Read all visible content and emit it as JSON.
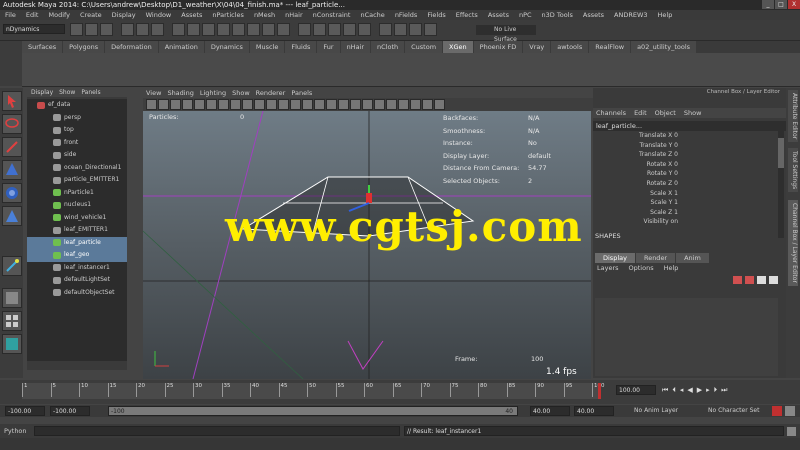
{
  "window": {
    "title": "Autodesk Maya 2014: C:\\Users\\andrew\\Desktop\\D1_weather\\X\\04\\04_finish.ma*   ---   leaf_particle...",
    "controls": [
      "_",
      "□",
      "X"
    ]
  },
  "menubar": [
    "File",
    "Edit",
    "Modify",
    "Create",
    "Display",
    "Window",
    "Assets",
    "nParticles",
    "nMesh",
    "nHair",
    "nConstraint",
    "nCache",
    "nFields",
    "Fields",
    "Effects",
    "Assets",
    "nPC",
    "n3D Tools",
    "Assets",
    "ANDREW3",
    "Help"
  ],
  "statusline": {
    "mode": "nDynamics",
    "live_surface": "No Live Surface"
  },
  "shelf_tabs": [
    "Surfaces",
    "Polygons",
    "Deformation",
    "Animation",
    "Dynamics",
    "Muscle",
    "Fluids",
    "Fur",
    "nHair",
    "nCloth",
    "Custom",
    "XGen",
    "Phoenix FD",
    "Vray",
    "awtools",
    "RealFlow",
    "a02_utility_tools"
  ],
  "shelf_active": "XGen",
  "outliner": {
    "menu": [
      "Display",
      "Show",
      "Panels"
    ],
    "items": [
      {
        "label": "ef_data",
        "color": "#c84c4c",
        "selected": false
      },
      {
        "label": "persp",
        "color": "#9a9a9a",
        "selected": false
      },
      {
        "label": "top",
        "color": "#9a9a9a",
        "selected": false
      },
      {
        "label": "front",
        "color": "#9a9a9a",
        "selected": false
      },
      {
        "label": "side",
        "color": "#9a9a9a",
        "selected": false
      },
      {
        "label": "ocean_Directional1",
        "color": "#9a9a9a",
        "selected": false
      },
      {
        "label": "particle_EMITTER1",
        "color": "#9a9a9a",
        "selected": false
      },
      {
        "label": "nParticle1",
        "color": "#6fbf4f",
        "selected": false
      },
      {
        "label": "nucleus1",
        "color": "#6fbf4f",
        "selected": false
      },
      {
        "label": "wind_vehicle1",
        "color": "#6fbf4f",
        "selected": false
      },
      {
        "label": "leaf_EMITTER1",
        "color": "#9a9a9a",
        "selected": false
      },
      {
        "label": "leaf_particle",
        "color": "#6fbf4f",
        "selected": true
      },
      {
        "label": "leaf_geo",
        "color": "#6fbf4f",
        "selected": true
      },
      {
        "label": "leaf_instancer1",
        "color": "#9a9a9a",
        "selected": false
      },
      {
        "label": "defaultLightSet",
        "color": "#9a9a9a",
        "selected": false
      },
      {
        "label": "defaultObjectSet",
        "color": "#9a9a9a",
        "selected": false
      }
    ]
  },
  "viewport": {
    "menu": [
      "View",
      "Shading",
      "Lighting",
      "Show",
      "Renderer",
      "Panels"
    ],
    "hud_left_label": "Particles:",
    "hud_left_value": "0",
    "hud_rows": [
      {
        "label": "Backfaces:",
        "value": "N/A"
      },
      {
        "label": "Smoothness:",
        "value": "N/A"
      },
      {
        "label": "Instance:",
        "value": "No"
      },
      {
        "label": "Display Layer:",
        "value": "default"
      },
      {
        "label": "Distance From Camera:",
        "value": "54.77"
      },
      {
        "label": "Selected Objects:",
        "value": "2"
      }
    ],
    "frame_label": "Frame:",
    "frame_value": "100",
    "fps": "1.4 fps",
    "watermark": "www.cgtsj.com"
  },
  "channelbox": {
    "header": "Channel Box / Layer Editor",
    "menu": [
      "Channels",
      "Edit",
      "Object",
      "Show"
    ],
    "object": "leaf_particle...",
    "attributes": [
      "Translate X 0",
      "Translate Y 0",
      "Translate Z 0",
      "Rotate X 0",
      "Rotate Y 0",
      "Rotate Z 0",
      "Scale X 1",
      "Scale Y 1",
      "Scale Z 1",
      "Visibility on"
    ],
    "shapes_label": "SHAPES",
    "layer_tabs": [
      "Display",
      "Render",
      "Anim"
    ],
    "layer_tab_active": "Display",
    "layer_menu": [
      "Layers",
      "Options",
      "Help"
    ]
  },
  "side_tabs": [
    "Attribute Editor",
    "Tool Settings",
    "Channel Box / Layer Editor"
  ],
  "timeline": {
    "ticks": [
      "1",
      "5",
      "10",
      "15",
      "20",
      "25",
      "30",
      "35",
      "40",
      "45",
      "50",
      "55",
      "60",
      "65",
      "70",
      "75",
      "80",
      "85",
      "90",
      "95",
      "100"
    ],
    "current_frame": "100.00"
  },
  "range": {
    "start": "-100.00",
    "playback_start": "-100.00",
    "slider_label": "-100",
    "slider_end": "40",
    "playback_end": "40.00",
    "end": "40.00",
    "anim_layer": "No Anim Layer",
    "character_set": "No Character Set"
  },
  "commandline": {
    "lang": "Python",
    "result": "// Result: leaf_instancer1"
  }
}
